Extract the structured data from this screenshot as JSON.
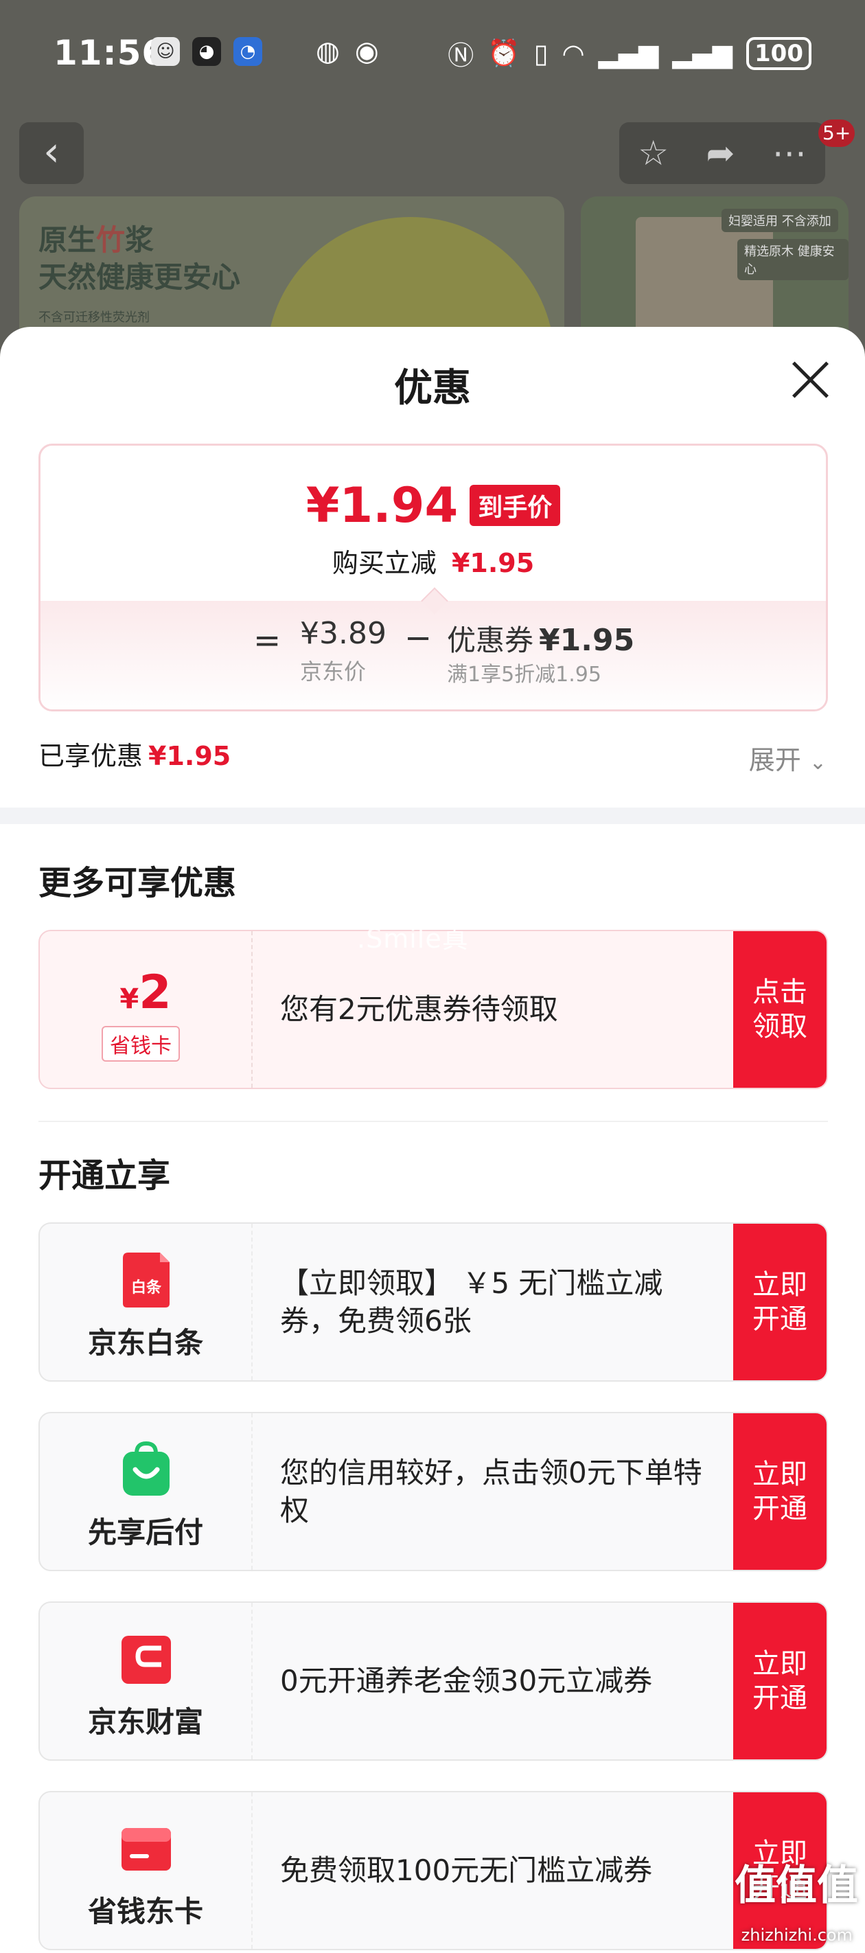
{
  "status_bar": {
    "time": "11:56",
    "battery": "100"
  },
  "background": {
    "nav_badge": "5+",
    "banner_left_line1a": "原生",
    "banner_left_line1b": "竹",
    "banner_left_line1c": "浆",
    "banner_left_line2": "天然健康更安心",
    "banner_left_line3": "不含可迁移性荧光剂",
    "banner_right_tag1": "妇婴适用 不含添加",
    "banner_right_tag2": "精选原木 健康安心"
  },
  "sheet": {
    "title": "优惠",
    "final_price": "¥1.94",
    "final_tag": "到手价",
    "instant_label": "购买立减",
    "instant_amount": "¥1.95",
    "equals": "=",
    "jd_price": "¥3.89",
    "jd_label": "京东价",
    "minus": "−",
    "coupon_label": "优惠券",
    "coupon_amount": "¥1.95",
    "coupon_rule": "满1享5折减1.95",
    "enjoyed_label": "已享优惠",
    "enjoyed_amount": "¥1.95",
    "expand_label": "展开"
  },
  "more_offers": {
    "title": "更多可享优惠",
    "card": {
      "yen": "¥",
      "amount": "2",
      "badge": "省钱卡",
      "text": "您有2元优惠券待领取",
      "button": "点击领取"
    }
  },
  "open_section": {
    "title": "开通立享",
    "items": [
      {
        "brand": "京东白条",
        "icon_text": "白条",
        "text": "【立即领取】 ￥5 无门槛立减券，免费领6张",
        "button": "立即开通"
      },
      {
        "brand": "先享后付",
        "text": "您的信用较好，点击领0元下单特权",
        "button": "立即开通"
      },
      {
        "brand": "京东财富",
        "text": "0元开通养老金领30元立减券",
        "button": "立即开通"
      },
      {
        "brand": "省钱东卡",
        "text": "免费领取100元无门槛立减券",
        "button": "立即开通"
      }
    ]
  },
  "watermarks": {
    "center": ".Smile真",
    "corner_logo": "值值值",
    "corner_url": "zhizhizhi.com"
  },
  "colors": {
    "accent_red": "#e4162f",
    "button_red": "#ef1831",
    "baitiao_red": "#ef2b3a",
    "xianxiang_green": "#22c46a"
  }
}
